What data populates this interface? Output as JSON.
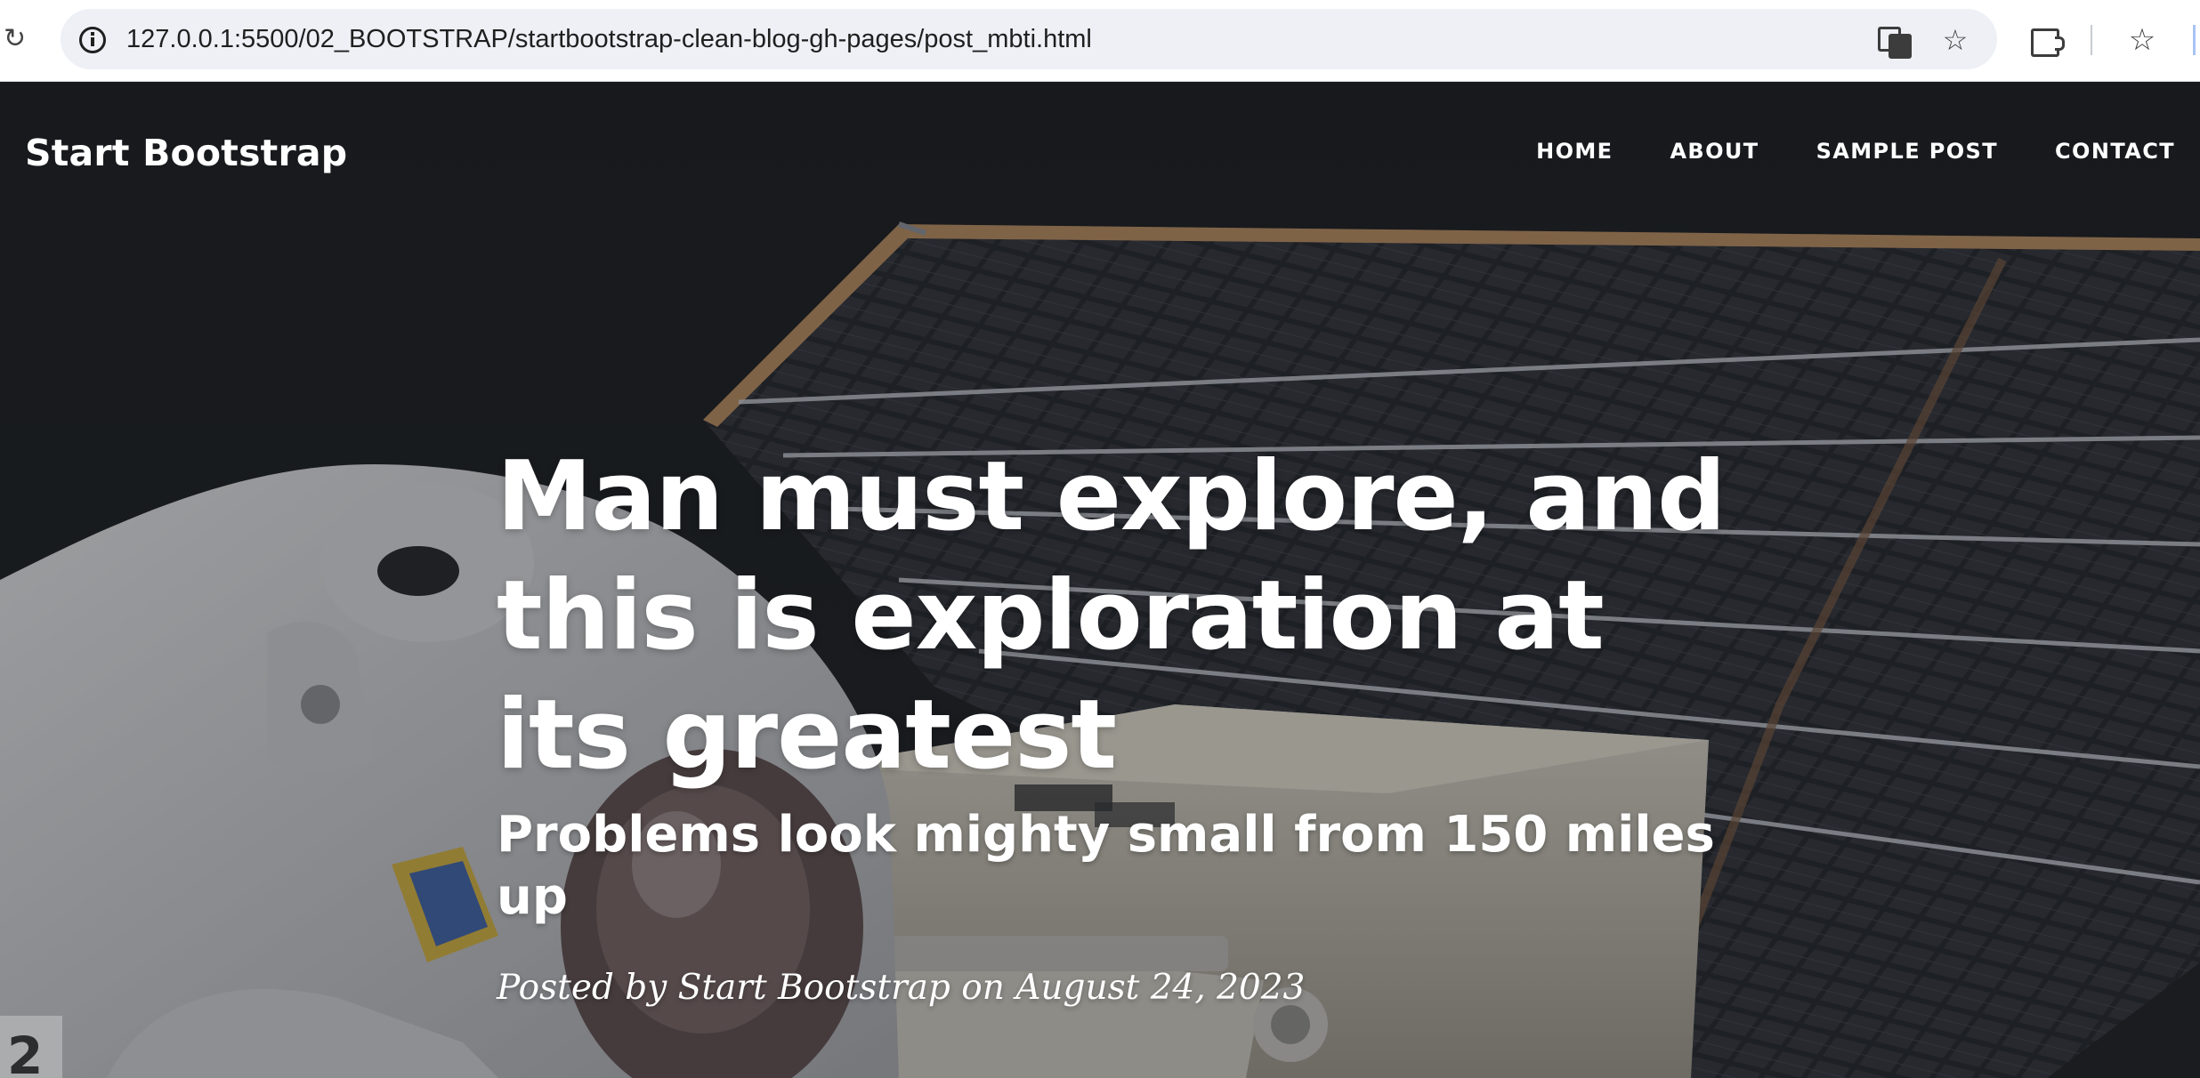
{
  "browser": {
    "url": "127.0.0.1:5500/02_BOOTSTRAP/startbootstrap-clean-blog-gh-pages/post_mbti.html",
    "icons": [
      "reload-icon",
      "site-info-icon",
      "translate-icon",
      "bookmark-star-icon",
      "extensions-icon",
      "bookmarks-icon"
    ]
  },
  "navbar": {
    "brand": "Start Bootstrap",
    "links": [
      "HOME",
      "ABOUT",
      "SAMPLE POST",
      "CONTACT"
    ]
  },
  "post": {
    "title": "Man must explore, and this is exploration at its greatest",
    "subheading": "Problems look mighty small from 150 miles up",
    "meta": "Posted by Start Bootstrap on August 24, 2023"
  },
  "colors": {
    "overlay": "#212529",
    "text": "#ffffff",
    "omnibox": "#eef0f6"
  }
}
